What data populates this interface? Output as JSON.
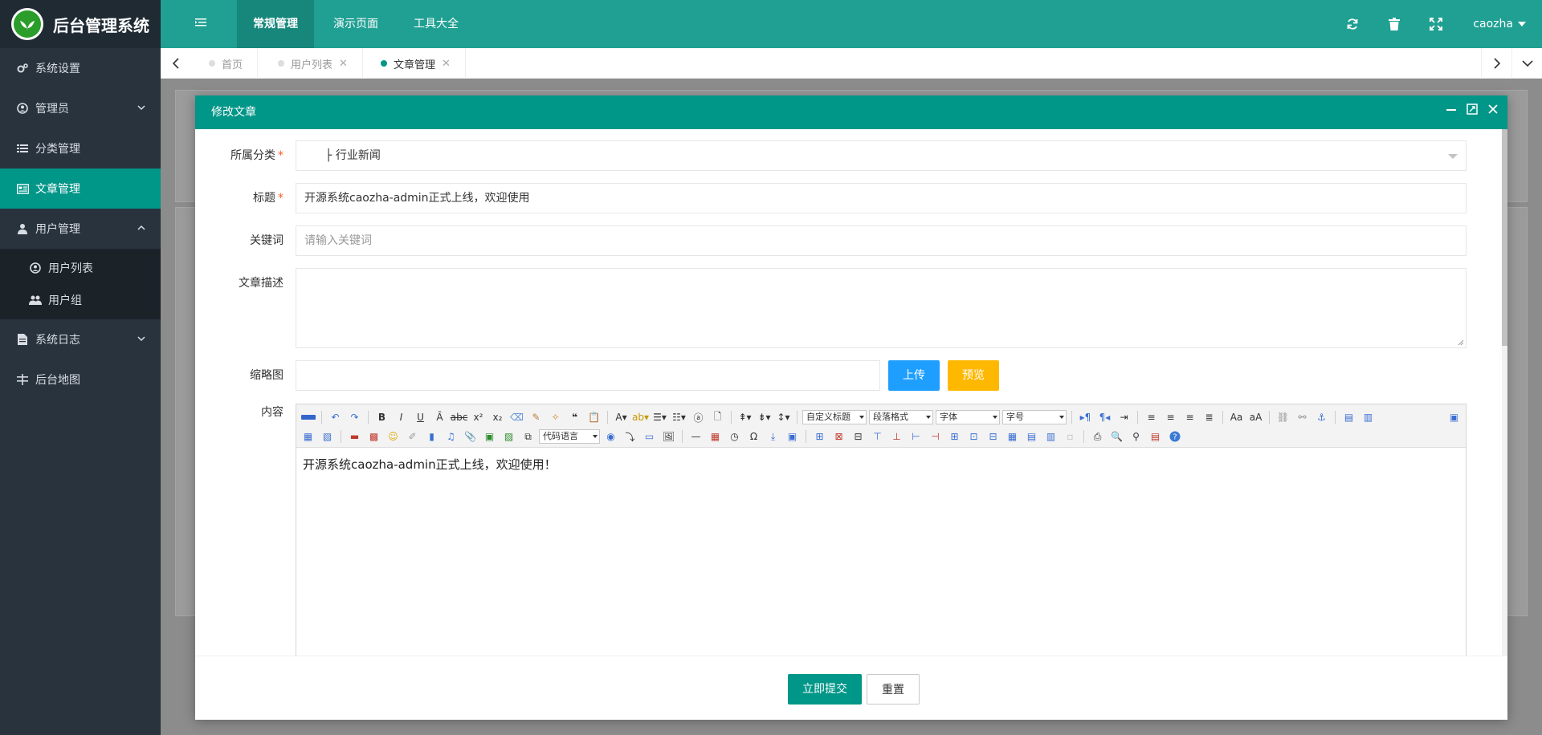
{
  "app": {
    "title": "后台管理系统"
  },
  "colors": {
    "primary": "#009688",
    "header": "#20a093",
    "sidebar": "#28333e",
    "blue": "#1e9fff",
    "yellow": "#ffb800"
  },
  "sidebar": {
    "items": [
      {
        "label": "系统设置",
        "icon": "gears-icon"
      },
      {
        "label": "管理员",
        "icon": "user-circle-icon"
      },
      {
        "label": "分类管理",
        "icon": "list-icon"
      },
      {
        "label": "文章管理",
        "icon": "newspaper-icon"
      },
      {
        "label": "用户管理",
        "icon": "user-icon"
      },
      {
        "label": "系统日志",
        "icon": "file-icon"
      },
      {
        "label": "后台地图",
        "icon": "sitemap-icon"
      }
    ],
    "sub": [
      {
        "label": "用户列表",
        "icon": "user-circle-icon"
      },
      {
        "label": "用户组",
        "icon": "users-icon"
      }
    ]
  },
  "header": {
    "tabs": [
      "常规管理",
      "演示页面",
      "工具大全"
    ],
    "user": "caozha"
  },
  "tabbar": {
    "tabs": [
      {
        "label": "首页"
      },
      {
        "label": "用户列表"
      },
      {
        "label": "文章管理"
      }
    ]
  },
  "modal": {
    "title": "修改文章",
    "form": {
      "category_label": "所属分类",
      "category_value": "├ 行业新闻",
      "title_label": "标题",
      "title_value": "开源系统caozha-admin正式上线，欢迎使用",
      "keywords_label": "关键词",
      "keywords_placeholder": "请输入关键词",
      "desc_label": "文章描述",
      "thumb_label": "缩略图",
      "upload_label": "上传",
      "preview_label": "预览",
      "content_label": "内容",
      "content_text": "开源系统caozha-admin正式上线，欢迎使用！"
    },
    "editor": {
      "selects": [
        "自定义标题",
        "段落格式",
        "字体",
        "字号",
        "代码语言"
      ]
    },
    "submit_label": "立即提交",
    "reset_label": "重置"
  }
}
